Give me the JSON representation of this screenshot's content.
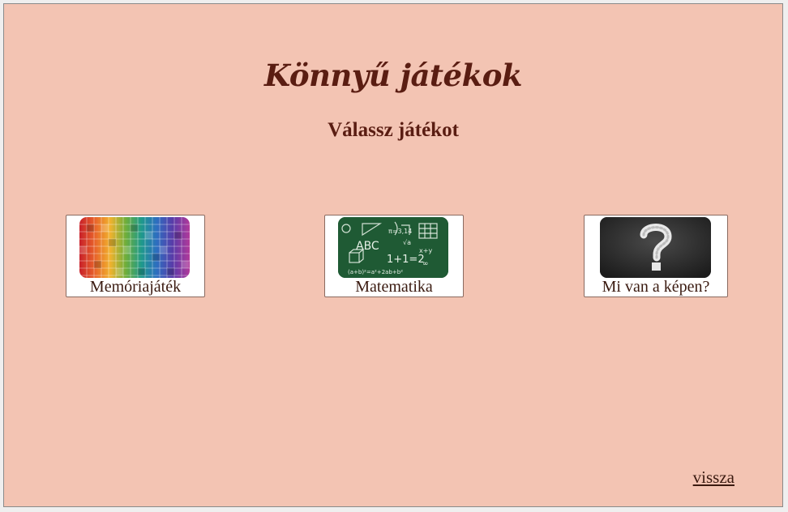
{
  "page": {
    "title": "Könnyű játékok",
    "subtitle": "Válassz játékot"
  },
  "games": [
    {
      "label": "Memóriajáték",
      "icon": "rainbow-photo-grid-icon"
    },
    {
      "label": "Matematika",
      "icon": "chalkboard-math-icon"
    },
    {
      "label": "Mi van a képen?",
      "icon": "question-mark-icon"
    }
  ],
  "footer": {
    "back_label": "vissza"
  },
  "colors": {
    "background": "#f3c4b3",
    "text": "#5a1d12",
    "card": "#ffffff"
  }
}
